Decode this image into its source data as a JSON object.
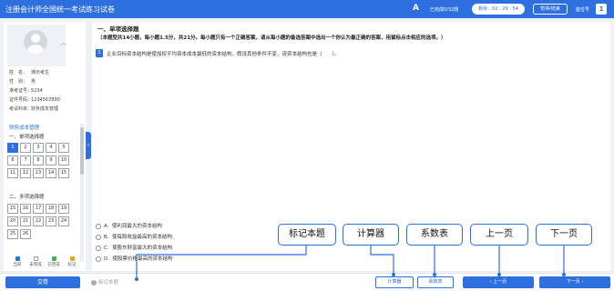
{
  "header": {
    "title": "注册会计师全国统一考试练习试卷",
    "font_icon": "A",
    "answered": "已完成0/32题",
    "timer": "剩余：02 : 29 : 54",
    "pause": "暂停/结束",
    "seat_label": "座位号",
    "seat_number": "1"
  },
  "candidate": {
    "rows": [
      {
        "label": "姓　名：",
        "value": "演示考生"
      },
      {
        "label": "性　别：",
        "value": "男"
      },
      {
        "label": "准考证号：",
        "value": "5234"
      },
      {
        "label": "证件号码：",
        "value": "1234567890"
      },
      {
        "label": "考试科目：",
        "value": "财务成本管理"
      }
    ]
  },
  "nav": {
    "category": "财务成本管理",
    "section1": "一、单项选择题",
    "section1_numbers": [
      "1",
      "2",
      "3",
      "4",
      "5",
      "6",
      "7",
      "8",
      "9",
      "10",
      "11",
      "12",
      "13",
      "14",
      "15"
    ],
    "section2": "二、多项选择题",
    "section2_numbers": [
      "15",
      "16",
      "17",
      "18",
      "19",
      "20",
      "21",
      "22",
      "23",
      "24",
      "25",
      "26"
    ],
    "legend": [
      "当前",
      "未完成",
      "已完成",
      "标记"
    ]
  },
  "question": {
    "section_heading": "一、单项选择题",
    "section_desc": "（本题型共14小题，每小题1.5分，共21分。每小题只有一个正确答案，请从每小题的备选答案中选出一个你认为最正确的答案，用鼠标点击相应的选项。）",
    "number": "1",
    "text": "企业目标资本结构是使加权平均资本成本最低的资本结构，假设其他条件不变，该资本结构也是（　　）。",
    "options": [
      {
        "letter": "A.",
        "text": "使利润最大的资本结构"
      },
      {
        "letter": "B.",
        "text": "使每股收益最高的资本结构"
      },
      {
        "letter": "C.",
        "text": "使股东财富最大的资本结构"
      },
      {
        "letter": "D.",
        "text": "使股票价格最高的资本结构"
      }
    ]
  },
  "bottom": {
    "submit": "交卷",
    "mark": "标记本题",
    "calculator": "计算器",
    "coef_table": "系数表",
    "prev": "上一页",
    "next": "下一页"
  },
  "callouts": {
    "mark": "标记本题",
    "calculator": "计算器",
    "coef_table": "系数表",
    "prev": "上一页",
    "next": "下一页"
  },
  "colors": {
    "primary": "#2e6fe0",
    "background": "#eef1f6",
    "legend_current": "#2e6fe0",
    "legend_undone": "#ffffff",
    "legend_done": "#4caf50",
    "legend_marked": "#f39c12"
  }
}
